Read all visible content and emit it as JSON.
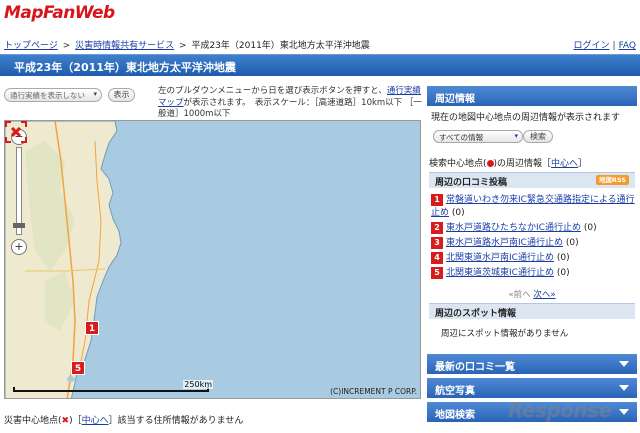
{
  "header": {
    "logo": "MapFanWeb",
    "breadcrumbs": [
      "トップページ",
      "災害時情報共有サービス",
      "平成23年（2011年）東北地方太平洋沖地震"
    ],
    "links": [
      "ログイン",
      "FAQ"
    ],
    "title": "平成23年（2011年）東北地方太平洋沖地震"
  },
  "controls": {
    "select_value": "通行実績を表示しない",
    "show_button": "表示",
    "description_pre": "左のプルダウンメニューから日を選び表示ボタンを押すと、",
    "description_link": "通行実績マップ",
    "description_post": "が表示されます。　表示スケール：［高速道路］10km以下 ［一般道］1000m以下"
  },
  "map": {
    "scale_label": "250km",
    "copyright": "(C)INCREMENT P CORP.",
    "markers": [
      "1",
      "5"
    ]
  },
  "footer_line": {
    "prefix": "災害中心地点(",
    "suffix": ")［",
    "link": "中心へ",
    "text": "］該当する住所情報がありません"
  },
  "sidebar": {
    "title": "周辺情報",
    "intro": "現在の地図中心地点の周辺情報が表示されます",
    "info_select": "すべての情報",
    "search_button": "検索",
    "center_pre": "検索中心地点(",
    "center_post": ")の周辺情報［",
    "center_link": "中心へ",
    "center_end": "］",
    "posts_title": "周辺の口コミ投稿",
    "rss": "地図RSS",
    "posts": [
      {
        "num": "1",
        "text": "常磐道いわき勿来IC緊急交通路指定による通行止め",
        "count": "(0)"
      },
      {
        "num": "2",
        "text": "東水戸道路ひたちなかIC通行止め",
        "count": "(0)"
      },
      {
        "num": "3",
        "text": "東水戸道路水戸南IC通行止め",
        "count": "(0)"
      },
      {
        "num": "4",
        "text": "北関東道水戸南IC通行止め",
        "count": "(0)"
      },
      {
        "num": "5",
        "text": "北関東道茨城東IC通行止め",
        "count": "(0)"
      }
    ],
    "pager_prev": "«前へ",
    "pager_next": "次へ»",
    "spots_title": "周辺のスポット情報",
    "spots_text": "周辺にスポット情報がありません",
    "sections": [
      "最新の口コミ一覧",
      "航空写真",
      "地図検索"
    ]
  },
  "watermark": "Response",
  "colors": {
    "accent": "#2a63b5",
    "marker": "#d81c1c",
    "sea": "#a9cbe2",
    "land": "#efe9cf"
  }
}
